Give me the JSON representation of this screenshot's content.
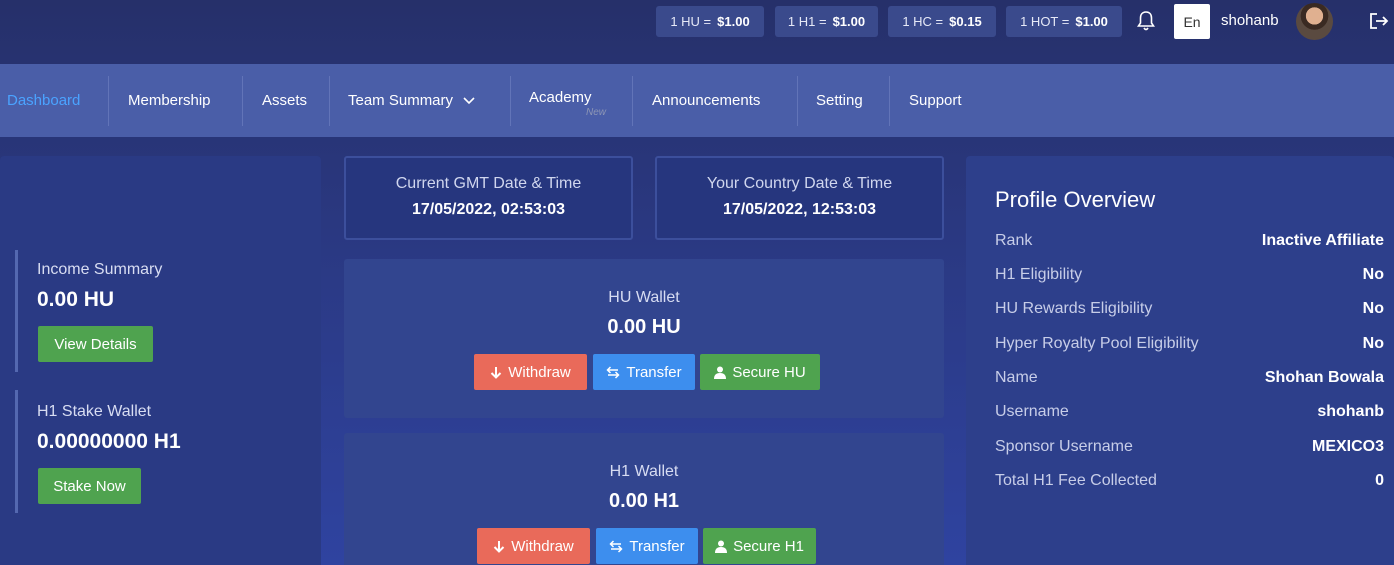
{
  "rates": [
    {
      "label": "1 HU =",
      "value": "$1.00"
    },
    {
      "label": "1 H1 =",
      "value": "$1.00"
    },
    {
      "label": "1 HC =",
      "value": "$0.15"
    },
    {
      "label": "1 HOT =",
      "value": "$1.00"
    }
  ],
  "header": {
    "language": "En",
    "username": "shohanb"
  },
  "nav": {
    "dashboard": "Dashboard",
    "membership": "Membership",
    "assets": "Assets",
    "team_summary": "Team Summary",
    "academy": "Academy",
    "academy_tag": "New",
    "announcements": "Announcements",
    "setting": "Setting",
    "support": "Support"
  },
  "income": {
    "title": "Income Summary",
    "value": "0.00 HU",
    "button": "View Details"
  },
  "stake": {
    "title": "H1 Stake Wallet",
    "value": "0.00000000 H1",
    "button": "Stake Now"
  },
  "gmt": {
    "title": "Current GMT Date & Time",
    "value": "17/05/2022, 02:53:03"
  },
  "local": {
    "title": "Your Country Date & Time",
    "value": "17/05/2022, 12:53:03"
  },
  "hu_wallet": {
    "title": "HU Wallet",
    "value": "0.00 HU",
    "withdraw": "Withdraw",
    "transfer": "Transfer",
    "secure": "Secure HU"
  },
  "h1_wallet": {
    "title": "H1 Wallet",
    "value": "0.00 H1",
    "withdraw": "Withdraw",
    "transfer": "Transfer",
    "secure": "Secure H1"
  },
  "profile": {
    "title": "Profile Overview",
    "rows": [
      {
        "k": "Rank",
        "v": "Inactive Affiliate"
      },
      {
        "k": "H1 Eligibility",
        "v": "No"
      },
      {
        "k": "HU Rewards Eligibility",
        "v": "No"
      },
      {
        "k": "Hyper Royalty Pool Eligibility",
        "v": "No"
      },
      {
        "k": "Name",
        "v": "Shohan Bowala"
      },
      {
        "k": "Username",
        "v": "shohanb"
      },
      {
        "k": "Sponsor Username",
        "v": "MEXICO3"
      },
      {
        "k": "Total H1 Fee Collected",
        "v": "0"
      }
    ]
  },
  "colors": {
    "accent": "#4aa3ff",
    "withdraw": "#e96a5a",
    "transfer": "#3d8eee",
    "secure": "#4fa34f"
  }
}
